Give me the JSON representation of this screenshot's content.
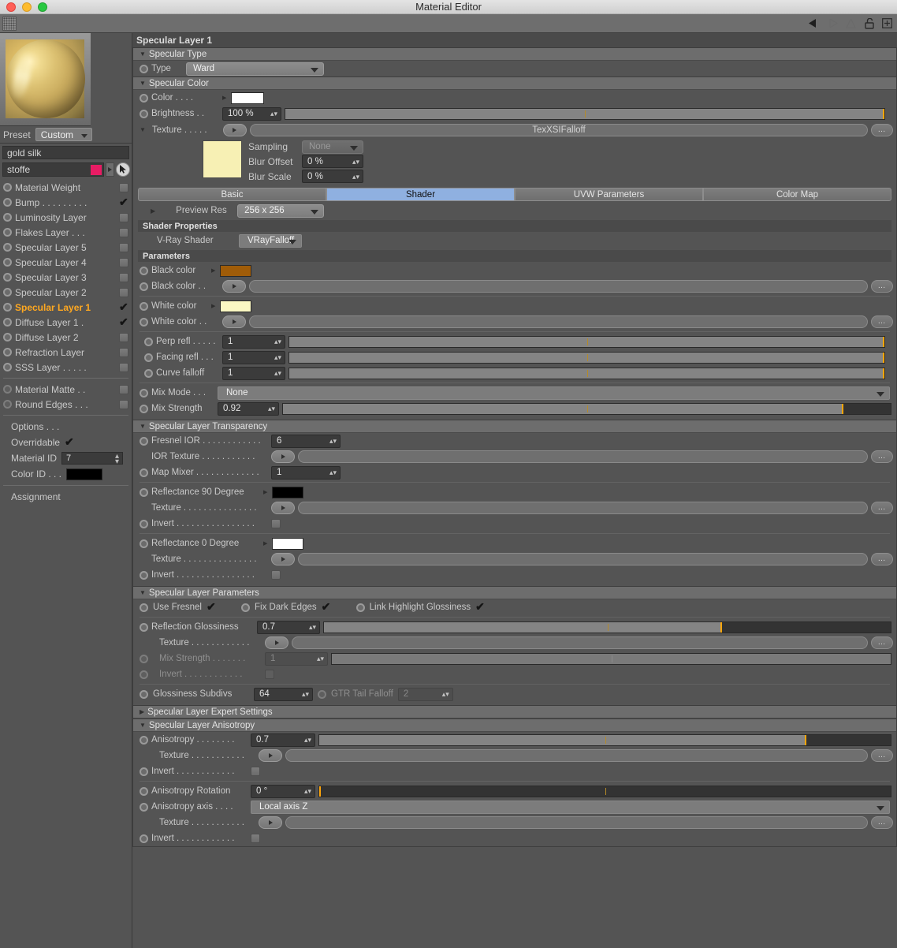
{
  "window": {
    "title": "Material Editor"
  },
  "toolbar": {
    "icons": [
      "back-arrow-icon",
      "forward-arrow-icon",
      "up-arrow-icon",
      "unlock-icon",
      "add-box-icon"
    ]
  },
  "sidebar": {
    "preview_label": "material-preview-sphere",
    "preset": {
      "label": "Preset",
      "value": "Custom"
    },
    "material_name": "gold silk",
    "material_group": "stoffe",
    "group_color": "#e81c64",
    "layers": [
      {
        "label": "Material Weight",
        "checked": false,
        "selected": false
      },
      {
        "label": "Bump . . . . . . . . .",
        "checked": true,
        "selected": false
      },
      {
        "label": "Luminosity Layer",
        "checked": false,
        "selected": false
      },
      {
        "label": "Flakes Layer . . .",
        "checked": false,
        "selected": false
      },
      {
        "label": "Specular Layer 5",
        "checked": false,
        "selected": false
      },
      {
        "label": "Specular Layer 4",
        "checked": false,
        "selected": false
      },
      {
        "label": "Specular Layer 3",
        "checked": false,
        "selected": false
      },
      {
        "label": "Specular Layer 2",
        "checked": false,
        "selected": false
      },
      {
        "label": "Specular Layer 1",
        "checked": true,
        "selected": true
      },
      {
        "label": "Diffuse Layer 1 .",
        "checked": true,
        "selected": false
      },
      {
        "label": "Diffuse Layer 2",
        "checked": false,
        "selected": false
      },
      {
        "label": "Refraction Layer",
        "checked": false,
        "selected": false
      },
      {
        "label": "SSS Layer . . . . .",
        "checked": false,
        "selected": false
      }
    ],
    "extra_layers": [
      {
        "label": "Material Matte . .",
        "checked": false
      },
      {
        "label": "Round Edges . . .",
        "checked": false
      }
    ],
    "options": {
      "title": "Options  . . .",
      "overridable_label": "Overridable",
      "overridable_checked": true,
      "material_id_label": "Material ID",
      "material_id_value": "7",
      "color_id_label": "Color ID . . .",
      "color_id_value": "#000000"
    },
    "assignment": "Assignment"
  },
  "main": {
    "header": "Specular Layer 1",
    "specular_type": {
      "title": "Specular Type",
      "type_label": "Type",
      "type_value": "Ward"
    },
    "specular_color": {
      "title": "Specular Color",
      "color_label": "Color  . . . .",
      "color_value": "#ffffff",
      "brightness_label": "Brightness . .",
      "brightness_value": "100 %",
      "brightness_slider_pct": 100,
      "texture_label": "Texture . . . . .",
      "texture_name": "TexXSIFalloff",
      "texture_thumb_color": "#f7f0b4",
      "sampling_label": "Sampling",
      "sampling_value": "None",
      "blur_offset_label": "Blur Offset",
      "blur_offset_value": "0 %",
      "blur_scale_label": "Blur Scale",
      "blur_scale_value": "0 %",
      "tabs": [
        {
          "label": "Basic",
          "active": false
        },
        {
          "label": "Shader",
          "active": true
        },
        {
          "label": "UVW Parameters",
          "active": false
        },
        {
          "label": "Color Map",
          "active": false
        }
      ],
      "preview_res_label": "Preview Res",
      "preview_res_value": "256 x 256",
      "shader_properties_title": "Shader Properties",
      "vray_shader_label": "V-Ray Shader",
      "vray_shader_value": "VRayFalloff",
      "parameters_title": "Parameters",
      "black_color_label": "Black color",
      "black_color_value": "#a05c08",
      "black_color_tex_label": "Black color  . .",
      "white_color_label": "White color",
      "white_color_value": "#fbf8c3",
      "white_color_tex_label": "White color . .",
      "perp_refl_label": "Perp refl . . . . .",
      "perp_refl_value": "1",
      "perp_refl_pct": 100,
      "facing_refl_label": "Facing refl . . .",
      "facing_refl_value": "1",
      "facing_refl_pct": 100,
      "curve_falloff_label": "Curve falloff",
      "curve_falloff_value": "1",
      "curve_falloff_pct": 100,
      "mix_mode_label": "Mix Mode . . .",
      "mix_mode_value": "None",
      "mix_strength_label": "Mix Strength",
      "mix_strength_value": "0.92",
      "mix_strength_pct": 92
    },
    "transparency": {
      "title": "Specular Layer Transparency",
      "fresnel_ior_label": "Fresnel IOR . . . . . . . . . . . .",
      "fresnel_ior_value": "6",
      "ior_texture_label": "IOR Texture . . . . . . . . . . .",
      "map_mixer_label": "Map Mixer . . . . . . . . . . . . .",
      "map_mixer_value": "1",
      "refl90_label": "Reflectance 90 Degree",
      "refl90_value": "#000000",
      "refl90_texture_label": "Texture . . . . . . . . . . . . . . .",
      "refl90_invert_label": "Invert . . . . . . . . . . . . . . . .",
      "refl90_invert_checked": false,
      "refl0_label": "Reflectance   0 Degree",
      "refl0_value": "#ffffff",
      "refl0_texture_label": "Texture . . . . . . . . . . . . . . .",
      "refl0_invert_label": "Invert . . . . . . . . . . . . . . . .",
      "refl0_invert_checked": false
    },
    "parameters": {
      "title": "Specular Layer Parameters",
      "use_fresnel_label": "Use Fresnel",
      "use_fresnel_checked": true,
      "fix_dark_edges_label": "Fix Dark Edges",
      "fix_dark_edges_checked": true,
      "link_highlight_label": "Link Highlight Glossiness",
      "link_highlight_checked": true,
      "reflection_glossiness_label": "Reflection Glossiness",
      "reflection_glossiness_value": "0.7",
      "reflection_glossiness_pct": 70,
      "texture_label": "Texture . . . . . . . . . . . .",
      "mix_strength_label": "Mix Strength . . . . . . .",
      "mix_strength_value": "1",
      "invert_label": "Invert . . . . . . . . . . . .",
      "invert_checked": false,
      "glossiness_subdivs_label": "Glossiness Subdivs",
      "glossiness_subdivs_value": "64",
      "gtr_tail_falloff_label": "GTR Tail Falloff",
      "gtr_tail_falloff_value": "2"
    },
    "expert_settings": {
      "title": "Specular Layer Expert Settings"
    },
    "anisotropy": {
      "title": "Specular Layer Anisotropy",
      "anisotropy_label": "Anisotropy . . . . . . . .",
      "anisotropy_value": "0.7",
      "anisotropy_pct": 70,
      "texture_label": "Texture . . . . . . . . . . .",
      "invert_label": "Invert . . . . . . . . . . . .",
      "invert_checked": false,
      "rotation_label": "Anisotropy Rotation",
      "rotation_value": "0 °",
      "rotation_pct": 0,
      "axis_label": "Anisotropy axis . . . .",
      "axis_value": "Local axis Z",
      "axis_texture_label": "Texture . . . . . . . . . . .",
      "axis_invert_label": "Invert . . . . . . . . . . . .",
      "axis_invert_checked": false
    }
  }
}
